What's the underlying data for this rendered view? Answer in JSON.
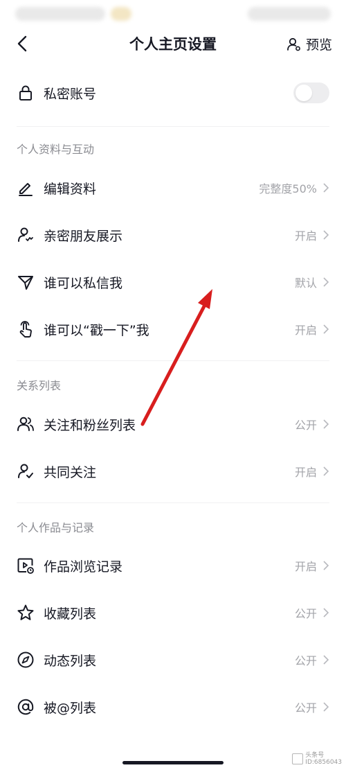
{
  "header": {
    "title": "个人主页设置",
    "preview_label": "预览"
  },
  "privacy": {
    "private_account_label": "私密账号",
    "private_account_on": false
  },
  "sections": {
    "profile_interaction": "个人资料与互动",
    "relations": "关系列表",
    "works_records": "个人作品与记录"
  },
  "rows": {
    "edit_profile": {
      "label": "编辑资料",
      "value": "完整度50%",
      "icon": "edit-pen-icon"
    },
    "close_friends": {
      "label": "亲密朋友展示",
      "value": "开启",
      "icon": "person-heart-icon"
    },
    "who_can_dm": {
      "label": "谁可以私信我",
      "value": "默认",
      "icon": "send-icon"
    },
    "who_can_poke": {
      "label": "谁可以“戳一下”我",
      "value": "开启",
      "icon": "tap-finger-icon"
    },
    "follow_fans": {
      "label": "关注和粉丝列表",
      "value": "公开",
      "icon": "people-icon"
    },
    "mutual_follow": {
      "label": "共同关注",
      "value": "开启",
      "icon": "person-check-icon"
    },
    "browse_history": {
      "label": "作品浏览记录",
      "value": "开启",
      "icon": "video-clock-icon"
    },
    "favorites": {
      "label": "收藏列表",
      "value": "公开",
      "icon": "star-icon"
    },
    "moments": {
      "label": "动态列表",
      "value": "公开",
      "icon": "compass-icon"
    },
    "mentioned": {
      "label": "被@列表",
      "value": "公开",
      "icon": "at-icon"
    }
  },
  "watermark": {
    "line1": "头条号",
    "line2": "ID:6856043"
  },
  "colors": {
    "text": "#161823",
    "secondary": "#a2a3a8",
    "arrow": "#d81e1e"
  }
}
